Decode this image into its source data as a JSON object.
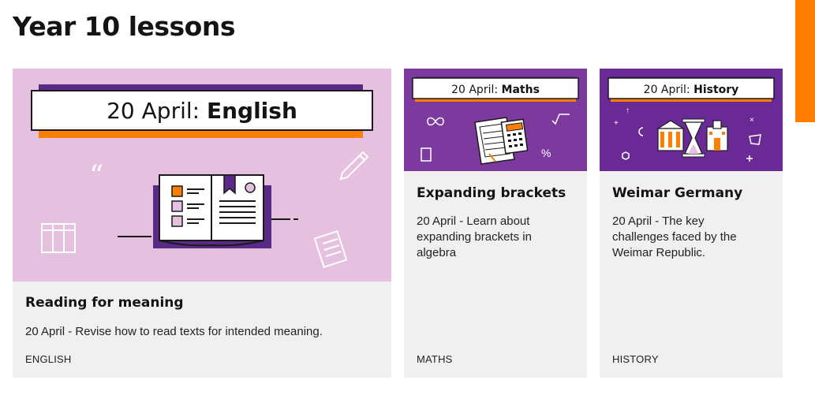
{
  "page": {
    "title": "Year 10 lessons"
  },
  "colors": {
    "accent": "#ff7d00",
    "purple": "#5b2a86",
    "lilac": "#e5c1df",
    "card_bg": "#f0f0f0"
  },
  "cards": [
    {
      "banner_prefix": "20 April: ",
      "banner_subject": "English",
      "title": "Reading for meaning",
      "description": "20 April - Revise how to read texts for intended meaning.",
      "tag": "ENGLISH",
      "icons": [
        "quote-icon",
        "book-icon",
        "pencil-icon",
        "books-icon",
        "notepad-icon"
      ]
    },
    {
      "banner_prefix": "20 April: ",
      "banner_subject": "Maths",
      "title": "Expanding brackets",
      "description_lines": [
        "20 April - Learn about",
        "expanding brackets in",
        "algebra"
      ],
      "tag": "MATHS",
      "icons": [
        "calculator-icon",
        "infinity-icon",
        "square-root-icon",
        "percent-icon"
      ]
    },
    {
      "banner_prefix": "20 April: ",
      "banner_subject": "History",
      "title": "Weimar Germany",
      "description_lines": [
        "20 April - The key",
        "challenges faced by the",
        "Weimar Republic."
      ],
      "tag": "HISTORY",
      "icons": [
        "hourglass-icon",
        "building-icon",
        "castle-icon",
        "hexagon-icon"
      ]
    }
  ]
}
